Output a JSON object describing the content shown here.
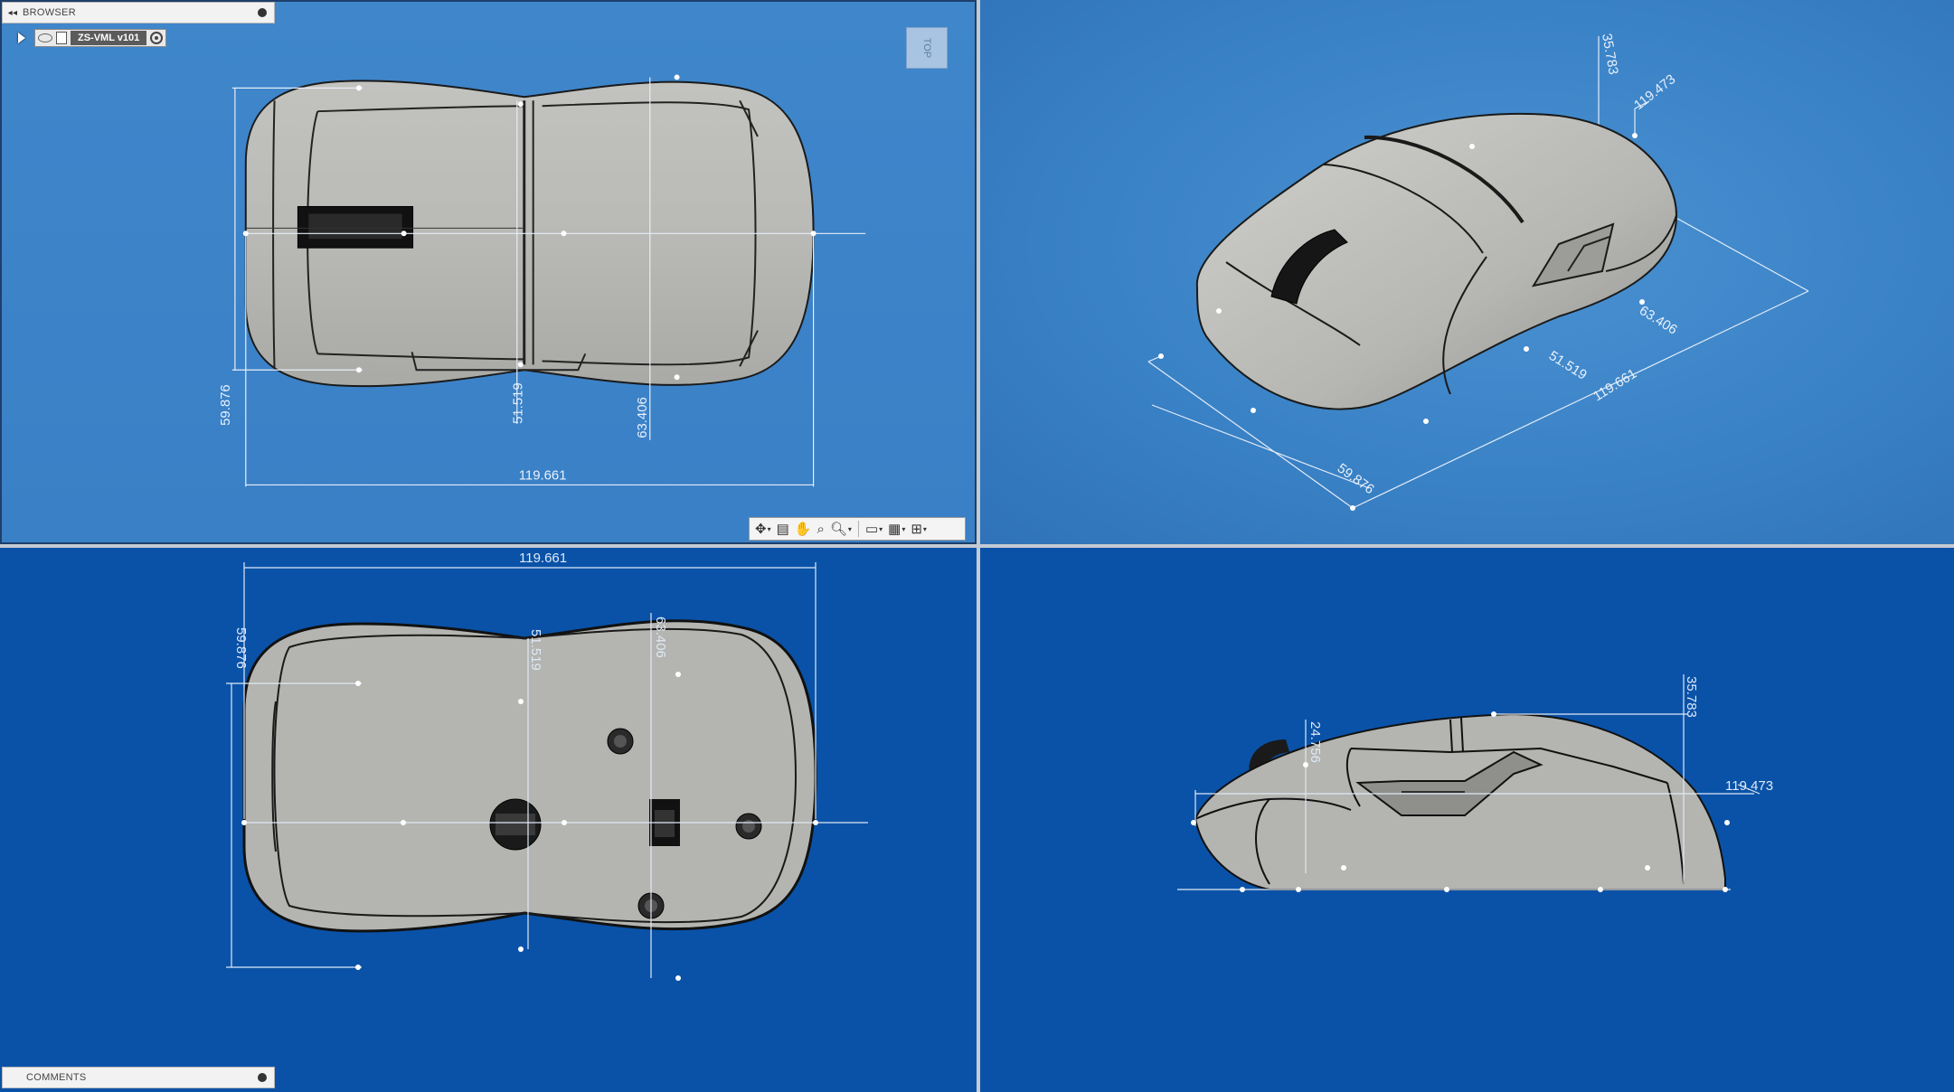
{
  "browser": {
    "title": "BROWSER",
    "component_name": "ZS-VML v101"
  },
  "comments": {
    "title": "COMMENTS"
  },
  "viewcube": {
    "face": "TOP"
  },
  "dimensions": {
    "top_view": {
      "length": "119.661",
      "width": "59.876",
      "mid_width": "51.519",
      "rear_width": "63.406"
    },
    "iso_view": {
      "height": "35.783",
      "length_side": "119.473",
      "rear_width": "63.406",
      "mid_width": "51.519",
      "length": "119.661",
      "front_width": "59.876"
    },
    "bottom_view": {
      "length": "119.661",
      "width": "59.876",
      "mid_width": "51.519",
      "rear_width": "63.406"
    },
    "side_view": {
      "height": "35.783",
      "front_height": "24.756",
      "length": "119.473"
    }
  },
  "colors": {
    "top_bg": "#3f86cb",
    "bottom_bg": "#0a52a8",
    "mouse_body": "#b4b4b0",
    "outline": "#1a1a1a"
  },
  "navbar": {
    "tools": [
      "orbit-icon",
      "look-at-icon",
      "pan-icon",
      "zoom-icon",
      "fit-icon",
      "display-settings-icon",
      "grid-icon",
      "viewports-icon"
    ]
  }
}
